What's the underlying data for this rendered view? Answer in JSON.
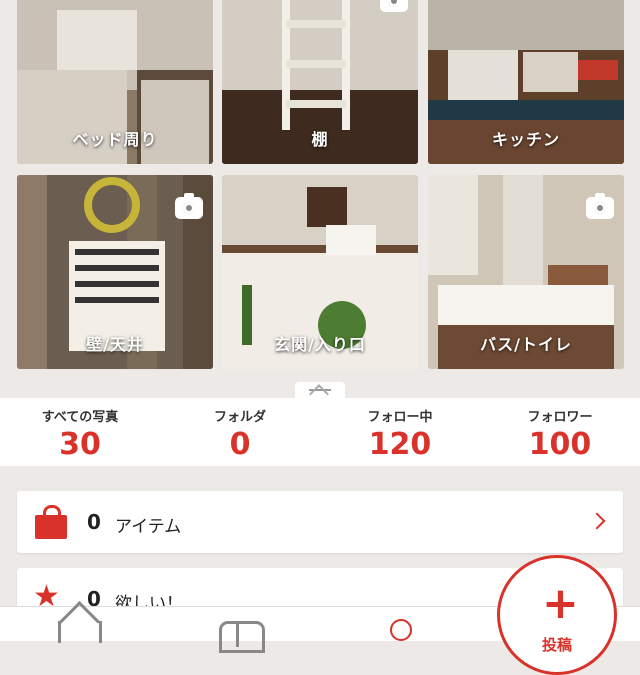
{
  "categories": [
    {
      "label": "ベッド周り",
      "camera_icon": false
    },
    {
      "label": "棚",
      "camera_icon": true
    },
    {
      "label": "キッチン",
      "camera_icon": false
    },
    {
      "label": "壁/天井",
      "camera_icon": true
    },
    {
      "label": "玄関/入り口",
      "camera_icon": false
    },
    {
      "label": "バス/トイレ",
      "camera_icon": true
    }
  ],
  "stats": [
    {
      "title": "すべての写真",
      "value": "30"
    },
    {
      "title": "フォルダ",
      "value": "0"
    },
    {
      "title": "フォロー中",
      "value": "120"
    },
    {
      "title": "フォロワー",
      "value": "100"
    }
  ],
  "items_card": {
    "count": "0",
    "label": "アイテム",
    "icon": "shopping-bag-icon"
  },
  "wants_card": {
    "count": "0",
    "label": "欲しい！",
    "icon": "star-icon"
  },
  "fab": {
    "label": "投稿",
    "icon": "plus-icon"
  },
  "tabbar": {
    "icons": [
      "home-icon",
      "folder-icon",
      "profile-icon"
    ]
  },
  "colors": {
    "accent": "#d9322a",
    "background": "#ece9e6"
  }
}
